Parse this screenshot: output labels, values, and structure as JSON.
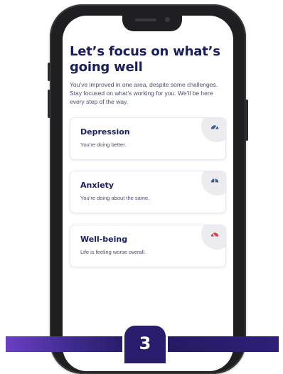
{
  "header": {
    "title": "Let’s focus on what’s going well",
    "subtitle": "You’ve improved in one area, despite some challenges. Stay focused on what’s working for you. We’ll be here every step of the way."
  },
  "cards": [
    {
      "title": "Depression",
      "status": "You’re doing better.",
      "icon": "gauge-icon",
      "icon_color": "#3d5f8a"
    },
    {
      "title": "Anxiety",
      "status": "You’re doing about the same.",
      "icon": "gauge-icon",
      "icon_color": "#3d5f8a"
    },
    {
      "title": "Well-being",
      "status": "Life is feeling worse overall.",
      "icon": "gauge-icon",
      "icon_color": "#c9414f"
    }
  ],
  "step": {
    "number": "3"
  },
  "colors": {
    "heading": "#1a1f5c",
    "body_text": "#4a4d68",
    "banner_dark": "#2a1d6e",
    "banner_accent": "#6a3fc3",
    "phone_frame": "#1f1f21"
  }
}
